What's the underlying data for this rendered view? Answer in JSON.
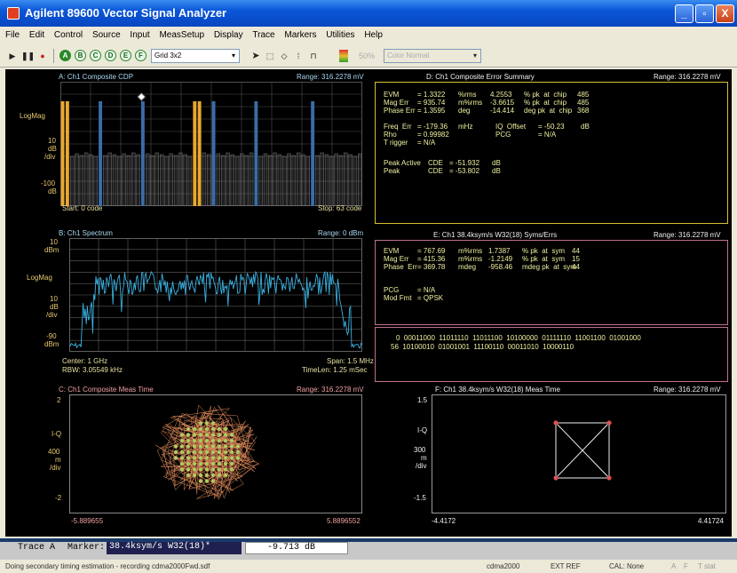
{
  "window": {
    "title": "Agilent 89600 Vector Signal Analyzer",
    "min": "_",
    "max": "▫",
    "close": "X"
  },
  "menu": [
    "File",
    "Edit",
    "Control",
    "Source",
    "Input",
    "MeasSetup",
    "Display",
    "Trace",
    "Markers",
    "Utilities",
    "Help"
  ],
  "toolbar": {
    "trace_buttons": [
      "A",
      "B",
      "C",
      "D",
      "E",
      "F"
    ],
    "layout_value": "Grid 3x2",
    "percent": "50%",
    "color_value": "Color Normal"
  },
  "traceA": {
    "title": "A: Ch1 Composite CDP",
    "range": "Range: 316.2278 mV",
    "ylabels": [
      "LogMag",
      "10",
      "dB",
      "/div",
      "-100",
      "dB"
    ],
    "start": "Start: 0  code",
    "stop": "Stop: 63  code",
    "colors": {
      "active": "#3a6ca8",
      "other": "#e8a830",
      "floor": "#c8c8c8"
    }
  },
  "traceB": {
    "title": "B: Ch1 Spectrum",
    "range": "Range: 0 dBm",
    "ylabels": [
      "10",
      "dBm",
      "LogMag",
      "10",
      "dB",
      "/div",
      "-90",
      "dBm"
    ],
    "center": "Center: 1 GHz",
    "span": "Span: 1.5 MHz",
    "rbw": "RBW: 3.05549 kHz",
    "timelen": "TimeLen: 1.25 mSec"
  },
  "traceC": {
    "title": "C: Ch1 Composite Meas Time",
    "range": "Range: 316.2278 mV",
    "ylabels": [
      "2",
      "I-Q",
      "400",
      "m",
      "/div",
      "-2"
    ],
    "xleft": "-5.889655",
    "xright": "5.8896552"
  },
  "traceD": {
    "title": "D: Ch1 Composite Error Summary",
    "range": "Range: 316.2278 mV",
    "rows": [
      [
        "EVM",
        "= 1.3322",
        "%rms",
        "4.2553",
        "% pk  at  chip",
        "485"
      ],
      [
        "Mag Err",
        "= 935.74",
        "m%rms",
        "-3.6615",
        "% pk  at  chip",
        "485"
      ],
      [
        "Phase Err",
        "= 1.3595",
        "deg",
        "-14.414",
        "deg pk  at  chip",
        "368"
      ]
    ],
    "freq_err": [
      "Freq  Err",
      "= -179.36",
      "mHz",
      "IQ  Offset",
      "= -50.23",
      "dB"
    ],
    "rho": [
      "Rho",
      "= 0.99982",
      "PCG",
      "= N/A"
    ],
    "trigger": [
      "T rigger",
      "= N/A"
    ],
    "peak_active": [
      "Peak Active",
      "CDE",
      "= -51.932",
      "dB"
    ],
    "peak": [
      "Peak",
      "CDE",
      "= -53.802",
      "dB"
    ]
  },
  "traceE": {
    "title": "E: Ch1 38.4ksym/s W32(18) Syms/Errs",
    "range": "Range: 316.2278 mV",
    "rows": [
      [
        "EVM",
        "= 767.69",
        "m%rms",
        "1.7387",
        "% pk  at  sym",
        "44"
      ],
      [
        "Mag Err",
        "= 415.36",
        "m%rms",
        "-1.2149",
        "% pk  at  sym",
        "15"
      ],
      [
        "Phase  Err",
        "= 369.78",
        "mdeg",
        "-958.46",
        "mdeg pk  at  sym",
        "44"
      ]
    ],
    "pcg": [
      "PCG",
      "= N/A"
    ],
    "modfmt": [
      "Mod Fmt",
      "= QPSK"
    ],
    "bits_line1": "0  00011000  11011110  11011100  10100000  01111110  11001100  01001000",
    "bits_line2": "56  10100010  01001001  11100110  00011010  10000110"
  },
  "traceF": {
    "title": "F: Ch1 38.4ksym/s W32(18) Meas Time",
    "range": "Range: 316.2278 mV",
    "ylabels": [
      "1.5",
      "I-Q",
      "300",
      "m",
      "/div",
      "-1.5"
    ],
    "xleft": "-4.4172",
    "xright": "4.41724"
  },
  "marker": {
    "trace": "Trace A",
    "label": "Marker:",
    "value": "38.4ksym/s W32(18)*",
    "reading": "-9.713  dB"
  },
  "status": {
    "message": "Doing secondary timing estimation  - recording cdma2000Fwd.sdf",
    "standard": "cdma2000",
    "ref": "EXT REF",
    "cal": "CAL: None",
    "flags": [
      "A",
      "F",
      "T stat"
    ]
  }
}
